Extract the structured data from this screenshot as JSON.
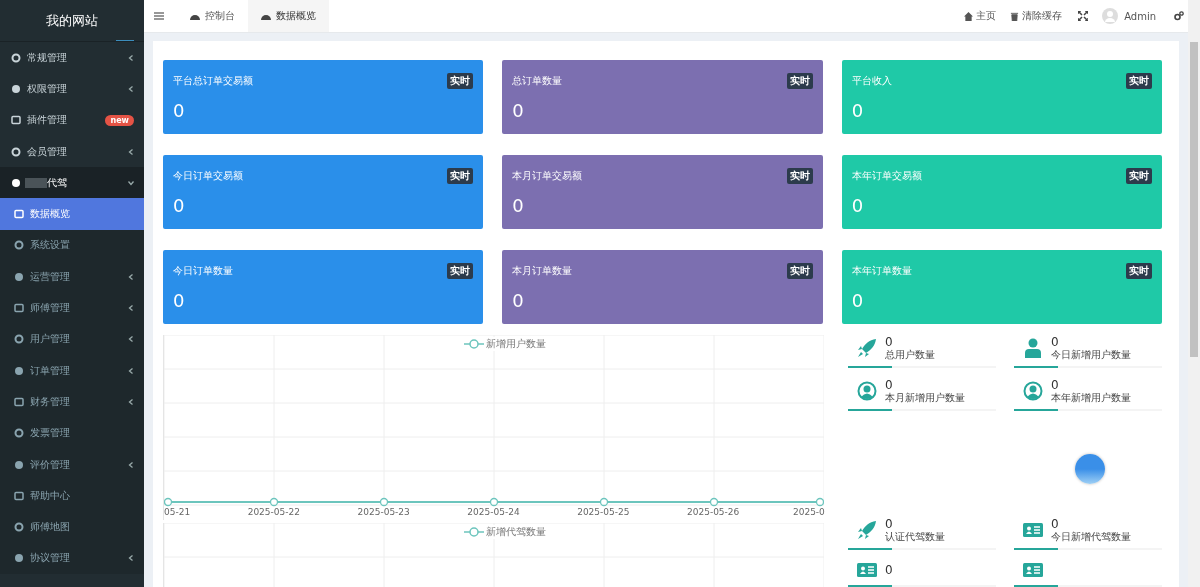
{
  "sidebar": {
    "title": "我的网站",
    "items": [
      {
        "label": "常规管理",
        "has_submenu": true,
        "expanded": false,
        "selected": false
      },
      {
        "label": "权限管理",
        "has_submenu": true,
        "expanded": false,
        "selected": false
      },
      {
        "label": "插件管理",
        "has_submenu": false,
        "expanded": false,
        "selected": false,
        "badge": "new"
      },
      {
        "label": "会员管理",
        "has_submenu": true,
        "expanded": false,
        "selected": false
      },
      {
        "label": "代驾",
        "has_submenu": true,
        "expanded": true,
        "selected": false,
        "children": [
          {
            "label": "数据概览",
            "has_submenu": false,
            "selected": true
          },
          {
            "label": "系统设置",
            "has_submenu": false,
            "selected": false
          },
          {
            "label": "运营管理",
            "has_submenu": true,
            "selected": false
          },
          {
            "label": "师傅管理",
            "has_submenu": true,
            "selected": false
          },
          {
            "label": "用户管理",
            "has_submenu": true,
            "selected": false
          },
          {
            "label": "订单管理",
            "has_submenu": true,
            "selected": false
          },
          {
            "label": "财务管理",
            "has_submenu": true,
            "selected": false
          },
          {
            "label": "发票管理",
            "has_submenu": false,
            "selected": false
          },
          {
            "label": "评价管理",
            "has_submenu": true,
            "selected": false
          },
          {
            "label": "帮助中心",
            "has_submenu": false,
            "selected": false
          },
          {
            "label": "师傅地图",
            "has_submenu": false,
            "selected": false
          },
          {
            "label": "协议管理",
            "has_submenu": true,
            "selected": false
          }
        ]
      }
    ]
  },
  "header": {
    "tabs": [
      {
        "label": "控制台",
        "selected": false
      },
      {
        "label": "数据概览",
        "selected": true
      }
    ],
    "links": [
      {
        "label": "主页"
      },
      {
        "label": "清除缓存"
      }
    ],
    "user": "Admin"
  },
  "cards": [
    {
      "title": "平台总订单交易额",
      "badge": "实时",
      "value": "0",
      "color": "#2a8fea"
    },
    {
      "title": "总订单数量",
      "badge": "实时",
      "value": "0",
      "color": "#7c6fb0"
    },
    {
      "title": "平台收入",
      "badge": "实时",
      "value": "0",
      "color": "#1fc9a7"
    },
    {
      "title": "今日订单交易额",
      "badge": "实时",
      "value": "0",
      "color": "#2a8fea"
    },
    {
      "title": "本月订单交易额",
      "badge": "实时",
      "value": "0",
      "color": "#7c6fb0"
    },
    {
      "title": "本年订单交易额",
      "badge": "实时",
      "value": "0",
      "color": "#1fc9a7"
    },
    {
      "title": "今日订单数量",
      "badge": "实时",
      "value": "0",
      "color": "#2a8fea"
    },
    {
      "title": "本月订单数量",
      "badge": "实时",
      "value": "0",
      "color": "#7c6fb0"
    },
    {
      "title": "本年订单数量",
      "badge": "实时",
      "value": "0",
      "color": "#1fc9a7"
    }
  ],
  "charts": [
    {
      "legend": "新增用户数量",
      "x_labels": [
        "05-21",
        "2025-05-22",
        "2025-05-23",
        "2025-05-24",
        "2025-05-25",
        "2025-05-26",
        "2025-0"
      ]
    },
    {
      "legend": "新增代驾数量"
    }
  ],
  "user_stats": [
    {
      "kind": "rocket",
      "value": "0",
      "label": "总用户数量"
    },
    {
      "kind": "person",
      "value": "0",
      "label": "今日新增用户数量"
    },
    {
      "kind": "avatar",
      "value": "0",
      "label": "本月新增用户数量"
    },
    {
      "kind": "avatar",
      "value": "0",
      "label": "本年新增用户数量"
    }
  ],
  "driver_stats": [
    {
      "kind": "rocket",
      "value": "0",
      "label": "认证代驾数量"
    },
    {
      "kind": "card",
      "value": "0",
      "label": "今日新增代驾数量"
    },
    {
      "kind": "card",
      "value": "0"
    },
    {
      "kind": "card"
    }
  ]
}
